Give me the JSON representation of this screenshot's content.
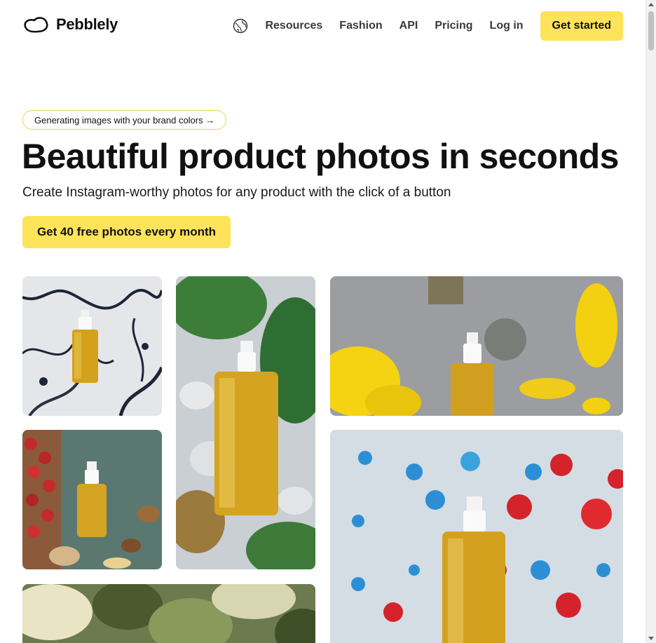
{
  "nav": {
    "brand": "Pebblely",
    "language_icon": "globe-icon",
    "links": [
      "Resources",
      "Fashion",
      "API",
      "Pricing",
      "Log in"
    ],
    "cta_label": "Get started"
  },
  "hero": {
    "announcement": "Generating images with your brand colors →",
    "headline": "Beautiful product photos in seconds",
    "subheadline": "Create Instagram-worthy photos for any product with the click of a button",
    "cta_label": "Get 40 free photos every month"
  },
  "colors": {
    "accent": "#fde35a",
    "text": "#111111",
    "background": "#ffffff"
  }
}
